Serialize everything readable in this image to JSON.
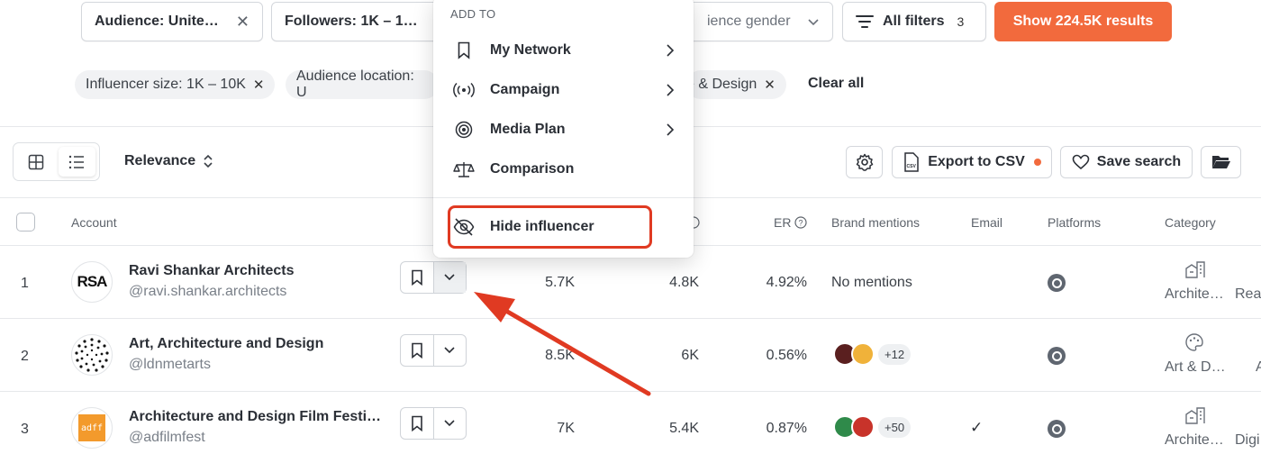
{
  "filters": {
    "audience": "Audience: Unite…",
    "followers": "Followers: 1K – 1…",
    "gender": "ience gender",
    "all_filters": "All filters",
    "all_filters_count": "3",
    "show_results": "Show 224.5K results"
  },
  "chips": [
    {
      "label": "Influencer size: 1K – 10K"
    },
    {
      "label": "Audience location: U"
    },
    {
      "label": "e & Design"
    }
  ],
  "clear_all": "Clear all",
  "toolbar": {
    "sort_label": "Relevance",
    "export_label": "Export to CSV",
    "save_search_label": "Save search",
    "csv_tag": "CSV"
  },
  "table": {
    "headers": {
      "account": "Account",
      "er": "ER",
      "brand_mentions": "Brand mentions",
      "email": "Email",
      "platforms": "Platforms",
      "category": "Category"
    },
    "rows": [
      {
        "num": "1",
        "name": "Ravi Shankar Architects",
        "handle": "@ravi.shankar.architects",
        "followers": "5.7K",
        "engagements": "4.8K",
        "er": "4.92%",
        "mentions": "No mentions",
        "email": "",
        "category": "Archite…",
        "category2": "Rea",
        "avatar_text": "RSA"
      },
      {
        "num": "2",
        "name": "Art, Architecture and Design",
        "handle": "@ldnmetarts",
        "followers": "8.5K",
        "engagements": "6K",
        "er": "0.56%",
        "mentions_more": "+12",
        "email": "",
        "category": "Art & D…",
        "category2": "A"
      },
      {
        "num": "3",
        "name": "Architecture and Design Film Festi…",
        "handle": "@adfilmfest",
        "followers": "7K",
        "engagements": "5.4K",
        "er": "0.87%",
        "mentions_more": "+50",
        "email": "✓",
        "category": "Archite…",
        "category2": "Digi",
        "avatar_text": "adff"
      }
    ]
  },
  "menu": {
    "header": "ADD TO",
    "items": [
      {
        "label": "My Network",
        "icon": "bookmark-icon",
        "has_submenu": true
      },
      {
        "label": "Campaign",
        "icon": "broadcast-icon",
        "has_submenu": true
      },
      {
        "label": "Media Plan",
        "icon": "target-icon",
        "has_submenu": true
      },
      {
        "label": "Comparison",
        "icon": "scale-icon",
        "has_submenu": false
      }
    ],
    "hide_label": "Hide influencer"
  },
  "colors": {
    "accent": "#f26a3d",
    "highlight": "#e03a22"
  }
}
